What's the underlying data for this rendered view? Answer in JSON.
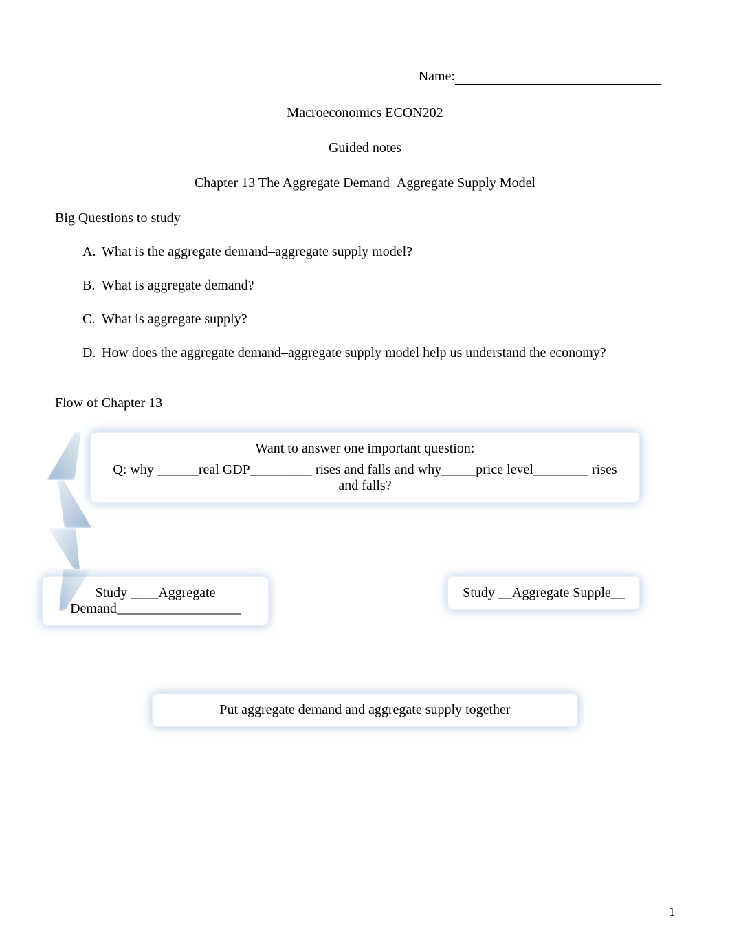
{
  "header": {
    "name_label": "Name:",
    "course": "Macroeconomics ECON202",
    "subtitle": "Guided notes",
    "chapter_title": "Chapter 13 The Aggregate Demand–Aggregate Supply Model"
  },
  "big_questions": {
    "heading": "Big Questions to study",
    "items": [
      {
        "marker": "A.",
        "text": "What is the aggregate demand–aggregate supply model?"
      },
      {
        "marker": "B.",
        "text": "What is aggregate demand?"
      },
      {
        "marker": "C.",
        "text": "What is aggregate supply?"
      },
      {
        "marker": "D.",
        "text": "How does the aggregate demand–aggregate supply model help us understand the economy?"
      }
    ]
  },
  "flow": {
    "title": "Flow of Chapter 13",
    "top_box": {
      "line1": "Want to answer one important question:",
      "q_prefix": "Q: why ",
      "blank1": "______real GDP_________",
      "mid1": " rises and falls and why",
      "blank2": "_____price level________",
      "mid2": " rises and falls?"
    },
    "left_box": {
      "prefix": "Study ",
      "blank": "____Aggregate Demand__________________"
    },
    "right_box": {
      "prefix": "Study ",
      "blank": "__Aggregate Supple__"
    },
    "bottom_box": {
      "text": "Put aggregate demand and aggregate supply together"
    }
  },
  "page_number": "1"
}
